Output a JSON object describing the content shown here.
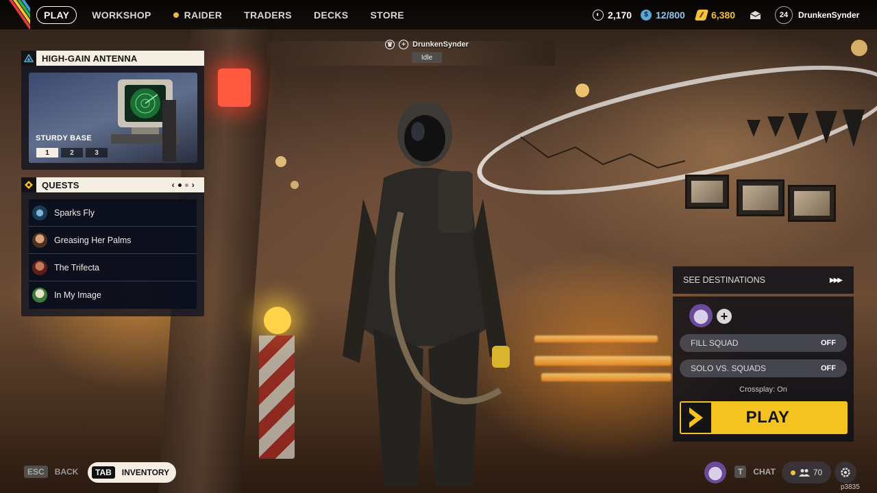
{
  "nav": {
    "items": [
      "PLAY",
      "WORKSHOP",
      "RAIDER",
      "TRADERS",
      "DECKS",
      "STORE"
    ],
    "active": "PLAY"
  },
  "currencies": {
    "coins": "2,170",
    "capacity": "12/800",
    "credits": "6,380"
  },
  "profile": {
    "level": "24",
    "username": "DrunkenSynder"
  },
  "antenna_panel": {
    "title": "HIGH-GAIN ANTENNA",
    "subtitle": "STURDY BASE",
    "tiers": [
      "1",
      "2",
      "3"
    ],
    "active_tier": "1"
  },
  "quests": {
    "title": "QUESTS",
    "items": [
      {
        "label": "Sparks Fly",
        "icon": "quest-sparks-icon"
      },
      {
        "label": "Greasing Her Palms",
        "icon": "quest-portrait-icon"
      },
      {
        "label": "The Trifecta",
        "icon": "quest-portrait-icon"
      },
      {
        "label": "In My Image",
        "icon": "quest-portrait-icon"
      }
    ]
  },
  "player_tag": {
    "name": "DrunkenSynder",
    "status": "Idle"
  },
  "play_panel": {
    "destinations_label": "SEE DESTINATIONS",
    "fill_squad_label": "FILL SQUAD",
    "fill_squad_value": "OFF",
    "solo_vs_squads_label": "SOLO VS. SQUADS",
    "solo_vs_squads_value": "OFF",
    "crossplay": "Crossplay: On",
    "play_label": "PLAY"
  },
  "bottom": {
    "esc_key": "ESC",
    "back_label": "BACK",
    "tab_key": "TAB",
    "inventory_label": "INVENTORY",
    "chat_key": "T",
    "chat_label": "CHAT",
    "friends_count": "70",
    "build_id": "p3835"
  },
  "colors": {
    "accent_yellow": "#f5c320",
    "panel_header": "#f4efe2",
    "panel_bg": "#141622"
  }
}
